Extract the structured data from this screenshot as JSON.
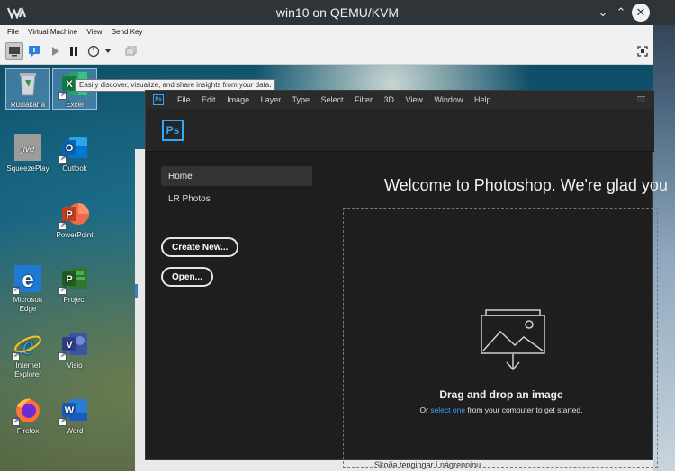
{
  "window": {
    "title": "win10 on QEMU/KVM",
    "controls": {
      "minimize": "⌄",
      "maximize": "⌃",
      "close": "✕"
    }
  },
  "menubar": {
    "items": [
      "File",
      "Virtual Machine",
      "View",
      "Send Key"
    ]
  },
  "toolbar": {
    "buttons": [
      "console-view",
      "details-view",
      "run",
      "pause",
      "power",
      "power-dropdown",
      "snapshots",
      "fullscreen"
    ]
  },
  "desktop": {
    "icons": [
      {
        "label": "Ruslakarfa",
        "icon": "recycle-bin-icon"
      },
      {
        "label": "Excel",
        "icon": "excel-icon"
      },
      {
        "label": "SqueezePlay",
        "icon": "squeezeplay-icon"
      },
      {
        "label": "Outlook",
        "icon": "outlook-icon"
      },
      {
        "label": "PowerPoint",
        "icon": "powerpoint-icon"
      },
      {
        "label": "Microsoft Edge",
        "icon": "edge-icon"
      },
      {
        "label": "Project",
        "icon": "project-icon"
      },
      {
        "label": "Internet Explorer",
        "icon": "ie-icon"
      },
      {
        "label": "Visio",
        "icon": "visio-icon"
      },
      {
        "label": "Firefox",
        "icon": "firefox-icon"
      },
      {
        "label": "Word",
        "icon": "word-icon"
      }
    ],
    "tooltip": "Easily discover, visualize, and share insights from your data."
  },
  "behind_window": {
    "text": "Skoða tengingar í nágrenninu."
  },
  "photoshop": {
    "logo": "Ps",
    "menu": [
      "File",
      "Edit",
      "Image",
      "Layer",
      "Type",
      "Select",
      "Filter",
      "3D",
      "View",
      "Window",
      "Help"
    ],
    "sidebar": {
      "home": "Home",
      "lr_photos": "LR Photos",
      "create_new": "Create New...",
      "open": "Open..."
    },
    "welcome": "Welcome to Photoshop. We're glad you",
    "dropzone": {
      "title": "Drag and drop an image",
      "sub_prefix": "Or ",
      "sub_link": "select one",
      "sub_suffix": " from your computer to get started."
    }
  }
}
